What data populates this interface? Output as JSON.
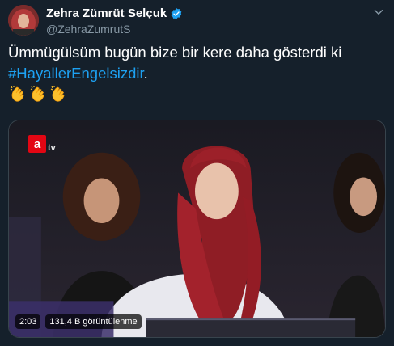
{
  "author": {
    "display_name": "Zehra Zümrüt Selçuk",
    "handle": "@ZehraZumrutS",
    "verified": true
  },
  "tweet": {
    "text_line1": "Ümmügülsüm bugün bize bir kere daha gösterdi ki",
    "hashtag": "#HayallerEngelsizdir",
    "hashtag_suffix": ".",
    "emojis": [
      "clapping-hands",
      "clapping-hands",
      "clapping-hands"
    ]
  },
  "video": {
    "duration": "2:03",
    "views": "131,4 B görüntülenme",
    "channel_logo_text": "tv"
  },
  "colors": {
    "background": "#15202b",
    "hashtag": "#1da1f2",
    "secondary_text": "#8899a6",
    "border": "#38444d",
    "verified": "#1da1f2",
    "atv_red": "#e30613"
  }
}
